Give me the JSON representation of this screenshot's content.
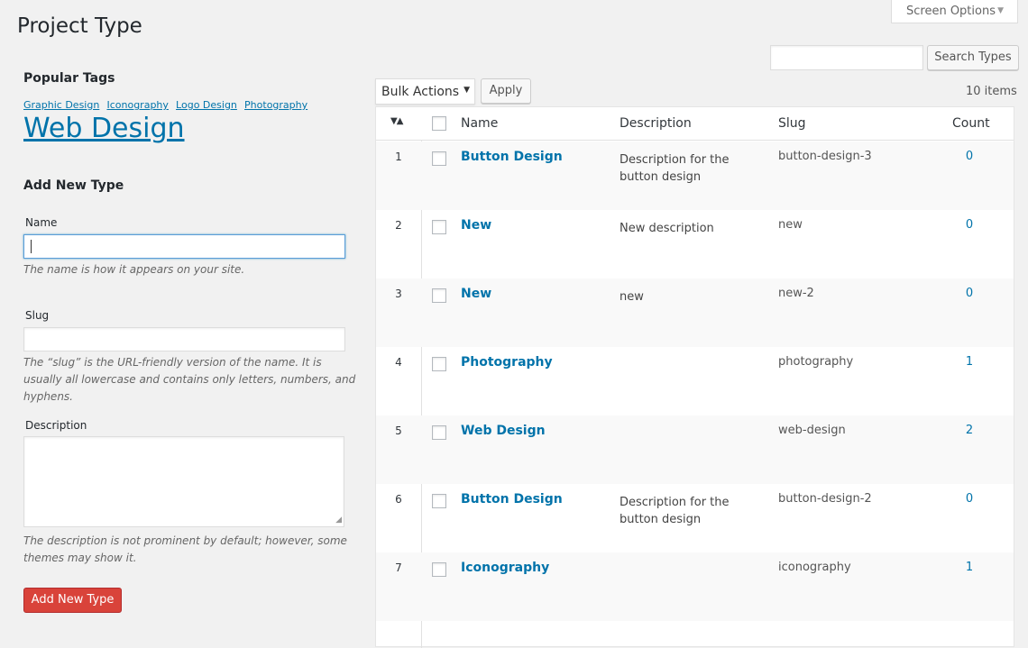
{
  "screen_options": {
    "label": "Screen Options",
    "arrow_icon": "triangle-down-icon"
  },
  "page": {
    "title": "Project Type"
  },
  "search": {
    "placeholder": "",
    "button_label": "Search Types"
  },
  "popular_tags": {
    "title": "Popular Tags",
    "tags": [
      {
        "label": "Graphic Design",
        "size": "small"
      },
      {
        "label": "Iconography",
        "size": "small"
      },
      {
        "label": "Logo Design",
        "size": "small"
      },
      {
        "label": "Photography",
        "size": "small"
      },
      {
        "label": "Web Design",
        "size": "large"
      }
    ]
  },
  "add_form": {
    "title": "Add New Type",
    "name_label": "Name",
    "name_value": "",
    "name_hint": "The name is how it appears on your site.",
    "slug_label": "Slug",
    "slug_value": "",
    "slug_hint": "The “slug” is the URL-friendly version of the name. It is usually all lowercase and contains only letters, numbers, and hyphens.",
    "description_label": "Description",
    "description_value": "",
    "description_hint": "The description is not prominent by default; however, some themes may show it.",
    "submit_label": "Add New Type"
  },
  "bulk": {
    "selected": "Bulk Actions",
    "apply_label": "Apply"
  },
  "items_count": "10 items",
  "table": {
    "sort_icon": "sort-triangles-icon",
    "headers": {
      "name": "Name",
      "description": "Description",
      "slug": "Slug",
      "count": "Count"
    },
    "rows": [
      {
        "order": "1",
        "name": "Button Design",
        "description": "Description for the button design",
        "slug": "button-design-3",
        "count": "0"
      },
      {
        "order": "2",
        "name": "New",
        "description": "New description",
        "slug": "new",
        "count": "0"
      },
      {
        "order": "3",
        "name": "New",
        "description": "new",
        "slug": "new-2",
        "count": "0"
      },
      {
        "order": "4",
        "name": "Photography",
        "description": "",
        "slug": "photography",
        "count": "1"
      },
      {
        "order": "5",
        "name": "Web Design",
        "description": "",
        "slug": "web-design",
        "count": "2"
      },
      {
        "order": "6",
        "name": "Button Design",
        "description": "Description for the button design",
        "slug": "button-design-2",
        "count": "0"
      },
      {
        "order": "7",
        "name": "Iconography",
        "description": "",
        "slug": "iconography",
        "count": "1"
      }
    ]
  },
  "colors": {
    "link": "#0073aa",
    "primary_button": "#d9433a",
    "background": "#f1f1f1"
  }
}
